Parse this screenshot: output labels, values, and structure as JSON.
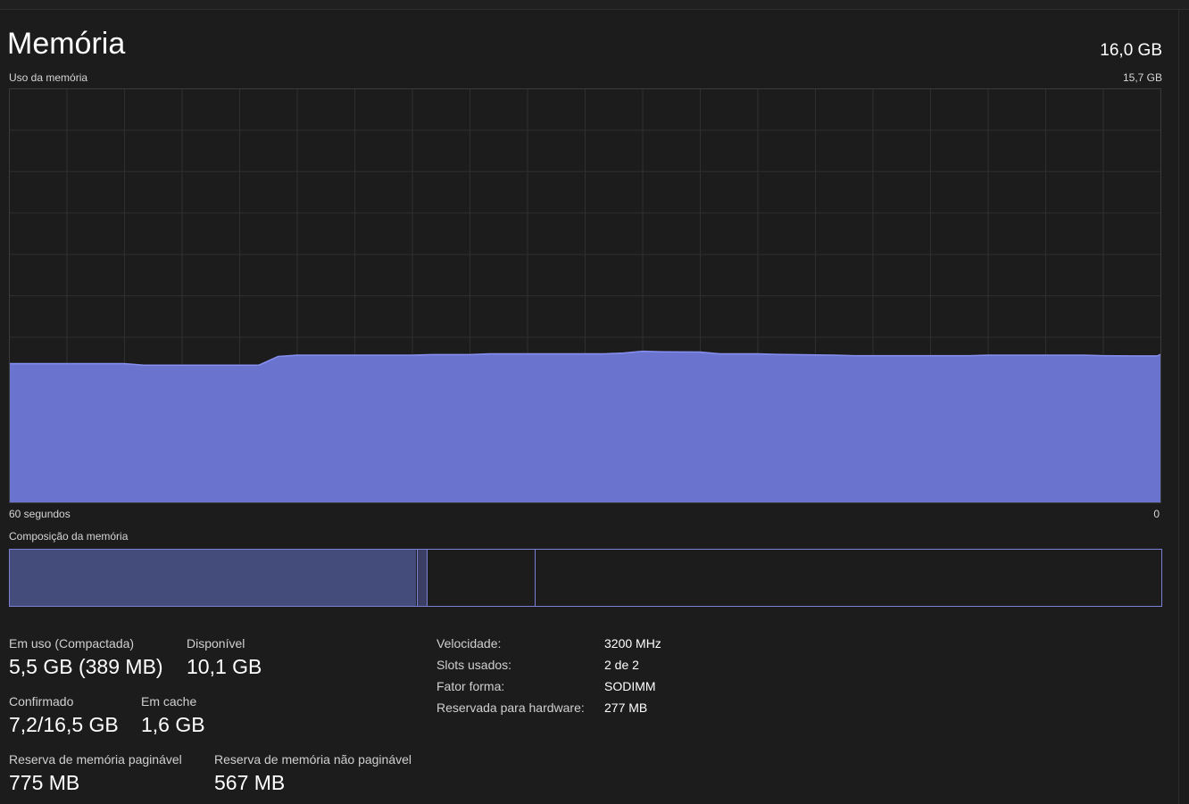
{
  "header": {
    "title": "Memória",
    "total": "16,0 GB"
  },
  "chart_labels": {
    "usage": "Uso da memória",
    "max": "15,7 GB",
    "time_left": "60 segundos",
    "time_right": "0",
    "composition": "Composição da memória"
  },
  "chart_data": {
    "type": "area",
    "ylim": [
      0,
      15.7
    ],
    "xlim": [
      60,
      0
    ],
    "grid": true,
    "color": "#6a74cf",
    "line_color": "#8790f0",
    "x": [
      60,
      57,
      54,
      53,
      50,
      47,
      46,
      45,
      43,
      42,
      39,
      38,
      36,
      35,
      33,
      31,
      29,
      28,
      27,
      26,
      24,
      23,
      21,
      20,
      17,
      16,
      14,
      13,
      10,
      9,
      7,
      6,
      4,
      3,
      1,
      0.2,
      0
    ],
    "values": [
      5.28,
      5.28,
      5.28,
      5.22,
      5.22,
      5.22,
      5.55,
      5.6,
      5.6,
      5.6,
      5.6,
      5.62,
      5.62,
      5.65,
      5.65,
      5.65,
      5.65,
      5.68,
      5.75,
      5.73,
      5.72,
      5.65,
      5.65,
      5.63,
      5.6,
      5.58,
      5.58,
      5.58,
      5.58,
      5.6,
      5.6,
      5.6,
      5.6,
      5.58,
      5.57,
      5.57,
      5.63
    ]
  },
  "stats": {
    "in_use_label": "Em uso (Compactada)",
    "in_use_value": "5,5 GB (389 MB)",
    "available_label": "Disponível",
    "available_value": "10,1 GB",
    "committed_label": "Confirmado",
    "committed_value": "7,2/16,5 GB",
    "cached_label": "Em cache",
    "cached_value": "1,6 GB",
    "paged_pool_label": "Reserva de memória paginável",
    "paged_pool_value": "775 MB",
    "nonpaged_pool_label": "Reserva de memória não paginável",
    "nonpaged_pool_value": "567 MB"
  },
  "specs": [
    {
      "label": "Velocidade:",
      "value": "3200 MHz"
    },
    {
      "label": "Slots usados:",
      "value": "2 de 2"
    },
    {
      "label": "Fator forma:",
      "value": "SODIMM"
    },
    {
      "label": "Reservada para hardware:",
      "value": "277 MB"
    }
  ]
}
